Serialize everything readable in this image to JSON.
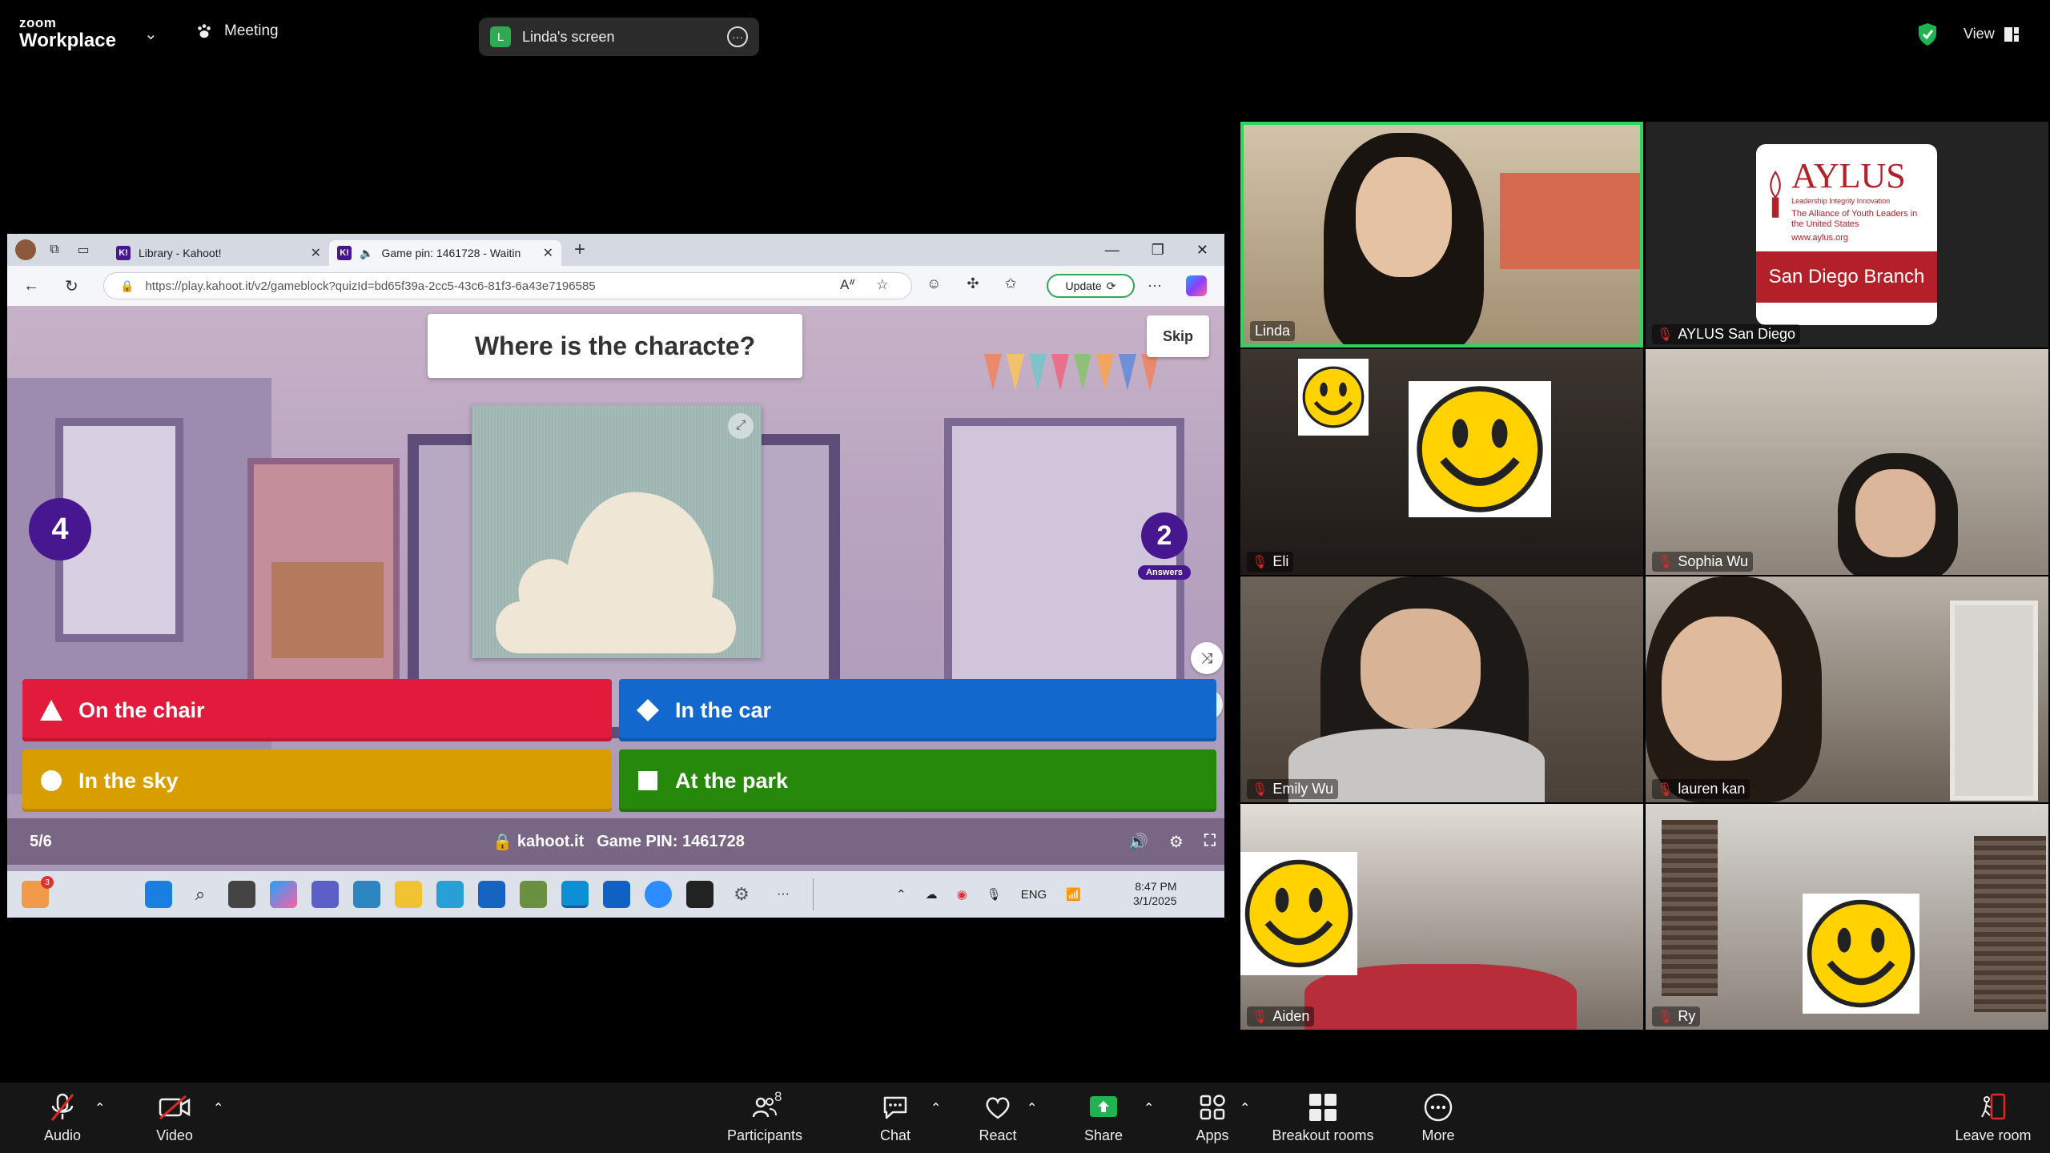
{
  "topbar": {
    "logo_top": "zoom",
    "logo_bottom": "Workplace",
    "meeting_label": "Meeting",
    "screen_initial": "L",
    "screen_label": "Linda's screen",
    "view_label": "View"
  },
  "browser": {
    "tabs": [
      {
        "title": "Library - Kahoot!",
        "favicon": "K!"
      },
      {
        "title": "Game pin: 1461728 - Waitin",
        "favicon": "K!"
      }
    ],
    "url": "https://play.kahoot.it/v2/gameblock?quizId=bd65f39a-2cc5-43c6-81f3-6a43e7196585",
    "update_label": "Update"
  },
  "kahoot": {
    "question": "Where is the characte?",
    "skip_label": "Skip",
    "timer": "4",
    "answers_count": "2",
    "answers_label": "Answers",
    "answers": [
      {
        "label": "On the chair",
        "shape": "triangle",
        "color": "#e21b3c"
      },
      {
        "label": "In the car",
        "shape": "diamond",
        "color": "#1368ce"
      },
      {
        "label": "In the sky",
        "shape": "circle",
        "color": "#d89e00"
      },
      {
        "label": "At the park",
        "shape": "square",
        "color": "#26890c"
      }
    ],
    "progress": "5/6",
    "site": "kahoot.it",
    "game_pin_label": "Game PIN: 1461728"
  },
  "taskbar": {
    "notification_count": "3",
    "lang": "ENG",
    "time": "8:47 PM",
    "date": "3/1/2025"
  },
  "participants": [
    {
      "name": "Linda",
      "muted": false,
      "active": true
    },
    {
      "name": "AYLUS San Diego",
      "muted": true,
      "active": false
    },
    {
      "name": "Eli",
      "muted": true,
      "active": false
    },
    {
      "name": "Sophia Wu",
      "muted": true,
      "active": false
    },
    {
      "name": "Emily Wu",
      "muted": true,
      "active": false
    },
    {
      "name": "lauren kan",
      "muted": true,
      "active": false
    },
    {
      "name": "Aiden",
      "muted": true,
      "active": false
    },
    {
      "name": "Ry",
      "muted": true,
      "active": false
    }
  ],
  "aylus": {
    "word": "AYLUS",
    "tag": "Leadership Integrity Innovation",
    "sub": "The Alliance of Youth Leaders in the United States",
    "site": "www.aylus.org",
    "band": "San Diego Branch"
  },
  "controls": {
    "audio": "Audio",
    "video": "Video",
    "participants": "Participants",
    "participants_count": "8",
    "chat": "Chat",
    "react": "React",
    "share": "Share",
    "apps": "Apps",
    "breakout": "Breakout rooms",
    "more": "More",
    "leave": "Leave room"
  }
}
